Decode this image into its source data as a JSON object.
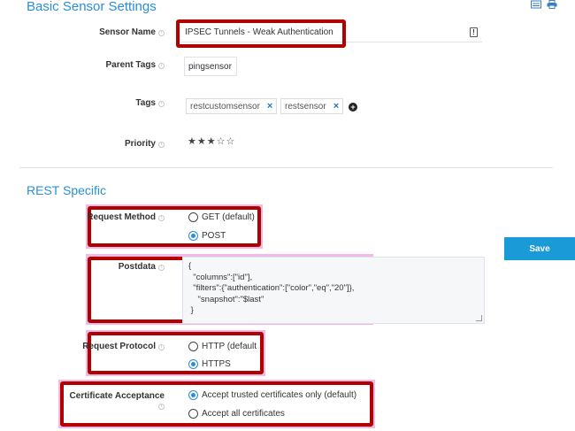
{
  "sections": {
    "basic_title": "Basic Sensor Settings",
    "rest_title": "REST Specific"
  },
  "fields": {
    "sensor_name": {
      "label": "Sensor Name",
      "value": "IPSEC Tunnels - Weak Authentication"
    },
    "parent_tags": {
      "label": "Parent Tags",
      "value": "pingsensor"
    },
    "tags": {
      "label": "Tags",
      "items": [
        "restcustomsensor",
        "restsensor"
      ]
    },
    "priority": {
      "label": "Priority",
      "stars_filled": 3,
      "stars_total": 5
    }
  },
  "request_method": {
    "label": "Request Method",
    "options": [
      {
        "label": "GET (default)",
        "selected": false
      },
      {
        "label": "POST",
        "selected": true
      }
    ]
  },
  "postdata": {
    "label": "Postdata",
    "value": "{\n  \"columns\":[\"id\"],\n  \"filters\":{\"authentication\":[\"color\",\"eq\",\"20\"]},\n    \"snapshot\":\"$last\"\n }"
  },
  "request_protocol": {
    "label": "Request Protocol",
    "options": [
      {
        "label": "HTTP (default",
        "selected": false
      },
      {
        "label": "HTTPS",
        "selected": true
      }
    ]
  },
  "certificate_acceptance": {
    "label": "Certificate Acceptance",
    "options": [
      {
        "label": "Accept trusted certificates only (default)",
        "selected": true
      },
      {
        "label": "Accept all certificates",
        "selected": false
      }
    ]
  },
  "buttons": {
    "save": "Save"
  },
  "colors": {
    "accent": "#2a8fd6",
    "highlight_box": "#b00000",
    "save_button": "#1a9ad6"
  },
  "icons": [
    "info-icon",
    "remove-tag-icon",
    "add-tag-icon",
    "star-icon",
    "print-icon",
    "export-icon"
  ]
}
